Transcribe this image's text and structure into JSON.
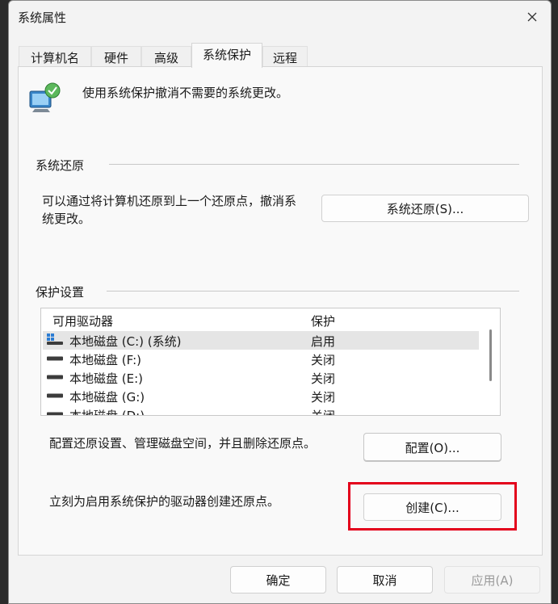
{
  "window": {
    "title": "系统属性"
  },
  "tabs": [
    {
      "label": "计算机名"
    },
    {
      "label": "硬件"
    },
    {
      "label": "高级"
    },
    {
      "label": "系统保护",
      "active": true
    },
    {
      "label": "远程"
    }
  ],
  "intro_text": "使用系统保护撤消不需要的系统更改。",
  "restore": {
    "group_label": "系统还原",
    "desc_line1": "可以通过将计算机还原到上一个还原点，撤消系",
    "desc_line2": "统更改。",
    "button": "系统还原(S)..."
  },
  "protection": {
    "group_label": "保护设置",
    "headers": {
      "drive": "可用驱动器",
      "status": "保护"
    },
    "drives": [
      {
        "name": "本地磁盘 (C:) (系统)",
        "status": "启用",
        "icon": "system-drive-icon"
      },
      {
        "name": "本地磁盘 (F:)",
        "status": "关闭",
        "icon": "drive-icon"
      },
      {
        "name": "本地磁盘 (E:)",
        "status": "关闭",
        "icon": "drive-icon"
      },
      {
        "name": "本地磁盘 (G:)",
        "status": "关闭",
        "icon": "drive-icon"
      },
      {
        "name": "本地磁盘 (D:)",
        "status": "关闭",
        "icon": "drive-icon"
      }
    ],
    "configure_desc": "配置还原设置、管理磁盘空间，并且删除还原点。",
    "configure_button": "配置(O)...",
    "create_desc": "立刻为启用系统保护的驱动器创建还原点。",
    "create_button": "创建(C)..."
  },
  "footer": {
    "ok": "确定",
    "cancel": "取消",
    "apply": "应用(A)"
  },
  "colors": {
    "highlight": "#e3001b",
    "selection": "#e5e5e5"
  }
}
